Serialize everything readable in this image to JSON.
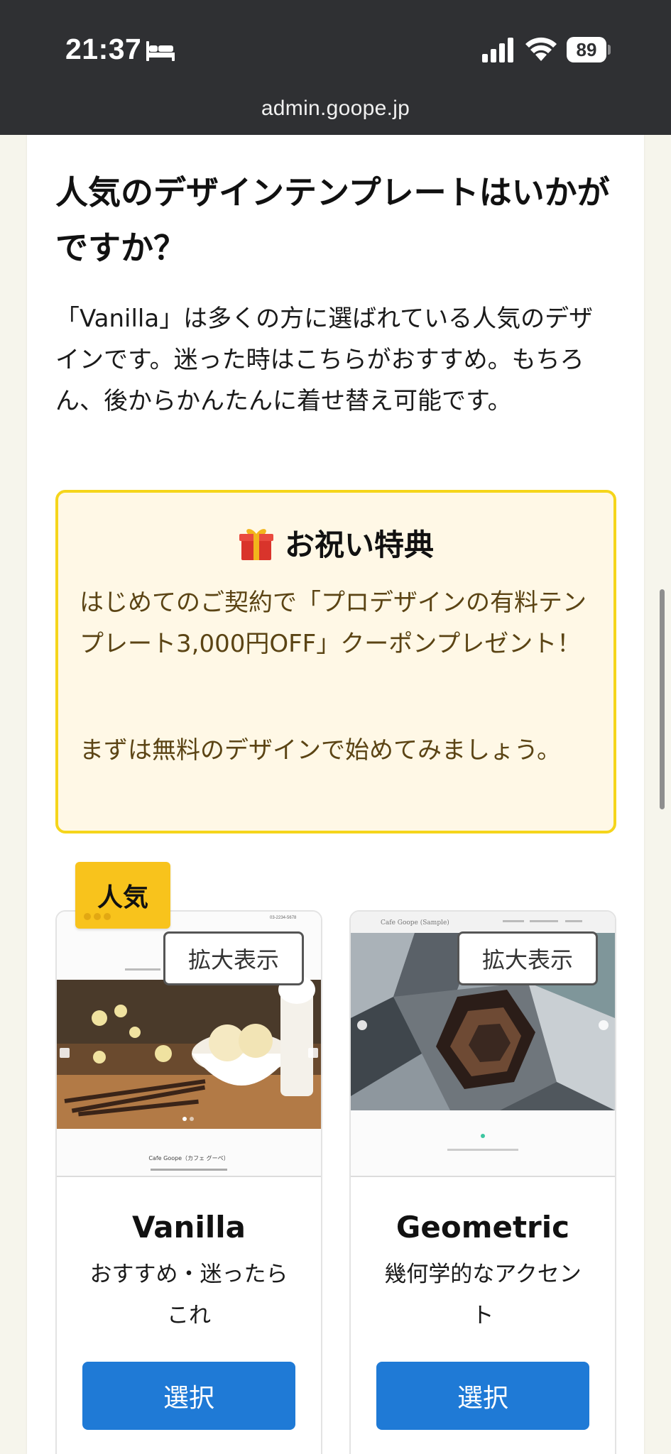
{
  "status_bar": {
    "time": "21:37",
    "battery": "89",
    "icons": [
      "bed-icon",
      "signal-icon",
      "wifi-icon",
      "battery-icon"
    ]
  },
  "browser": {
    "url": "admin.goope.jp"
  },
  "main": {
    "heading": "人気のデザインテンプレートはいかがですか？",
    "intro": "「Vanilla」は多くの方に選ばれている人気のデザインです。迷った時はこちらがおすすめ。もちろん、後からかんたんに着せ替え可能です。"
  },
  "promo": {
    "title": "お祝い特典",
    "icon": "gift-icon",
    "text1": "はじめてのご契約で「プロデザインの有料テンプレート3,000円OFF」クーポンプレゼント！",
    "text2": "まずは無料のデザインで始めてみましょう。"
  },
  "templates": [
    {
      "badge": "人気",
      "zoom_label": "拡大表示",
      "name": "Vanilla",
      "description": "おすすめ・迷ったらこれ",
      "select_label": "選択",
      "preview_site_title": "Cafe Goope（カフェ グーペ）",
      "preview_phone": "03-2234-5678"
    },
    {
      "zoom_label": "拡大表示",
      "name": "Geometric",
      "description": "幾何学的なアクセント",
      "select_label": "選択",
      "preview_site_title": "Cafe Goope (Sample)"
    }
  ],
  "colors": {
    "chrome_bg": "#2f3033",
    "page_bg": "#f6f5ec",
    "promo_border": "#f5d51b",
    "promo_bg": "#fff8e6",
    "promo_text": "#5b4414",
    "badge": "#f8c31c",
    "button": "#1f7ad6"
  }
}
